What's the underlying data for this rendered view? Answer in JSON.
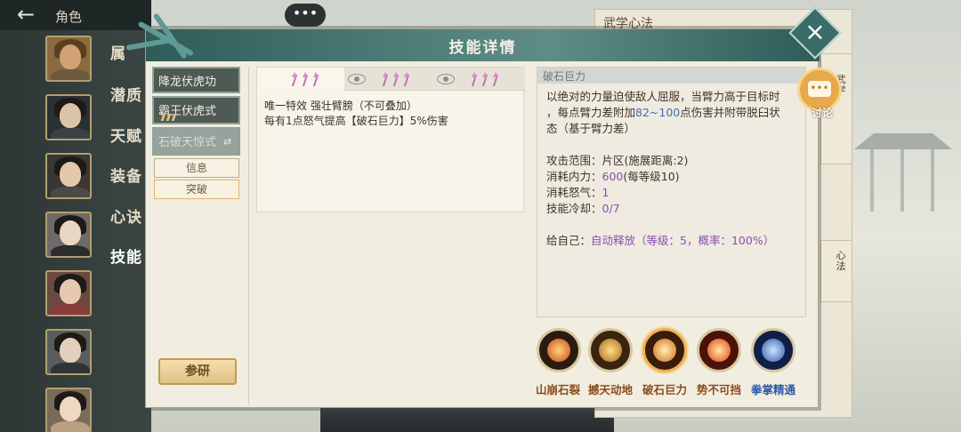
{
  "top": {
    "back_icon": "back-arrow-icon",
    "title": "角色",
    "chat_icon": "chat-bubble-icon",
    "chat_dots": "•••"
  },
  "side_nav": [
    "属",
    "潜质",
    "天赋",
    "装备",
    "心诀",
    "技能"
  ],
  "side_nav_active": "技能",
  "right_panel": {
    "tab_label": "武学心法",
    "scroll_label_1": "武学",
    "scroll_label_2": "心法"
  },
  "modal": {
    "title": "技能详情",
    "close_icon": "close-icon",
    "skills": [
      {
        "label": "降龙伏虎功"
      },
      {
        "label": "霸王伏虎式"
      },
      {
        "label": "石破天惊式",
        "swap_icon": "swap-icon",
        "swap_glyph": "⇄"
      }
    ],
    "info_button": "信息",
    "breakthrough_button": "突破",
    "research_button": "参研",
    "effects": [
      "唯一特效 强壮臂膀（不可叠加）",
      "每有1点怒气提高【破石巨力】5%伤害"
    ],
    "detail": {
      "name": "破石巨力",
      "desc_1": "以绝对的力量迫使敌人屈服，当臂力高于目标时",
      "desc_2a": "，每点臂力差附加",
      "desc_2b": "82~100",
      "desc_2c": "点伤害并附带脱臼状",
      "desc_3": "态（基于臂力差）",
      "range_label": "攻击范围：",
      "range_value": "片区(施展距离:2)",
      "mp_label": "消耗内力：",
      "mp_value": "600",
      "mp_extra": "(每等级10)",
      "rage_label": "消耗怒气：",
      "rage_value": "1",
      "cd_label": "技能冷却：",
      "cd_value": "0/7",
      "self_label": "给自己：",
      "self_value": "自动释放（等级：5，概率：100%）"
    },
    "skill_icons": [
      {
        "name": "山崩石裂",
        "color": "#8b4d1a",
        "selected": false
      },
      {
        "name": "撼天动地",
        "color": "#8b4d1a",
        "selected": false
      },
      {
        "name": "破石巨力",
        "color": "#8b4d1a",
        "selected": true
      },
      {
        "name": "势不可挡",
        "color": "#8b4d1a",
        "selected": false
      },
      {
        "name": "拳掌精通",
        "color": "#2f5aa8",
        "selected": false
      }
    ]
  },
  "discuss": {
    "label": "讨论",
    "icon": "discussion-icon",
    "dots": "•••"
  },
  "colors": {
    "accent_teal": "#3b6c68",
    "highlight_blue": "#3f6fb7",
    "highlight_purple": "#8a4fb2",
    "gold": "#e7a94a"
  }
}
